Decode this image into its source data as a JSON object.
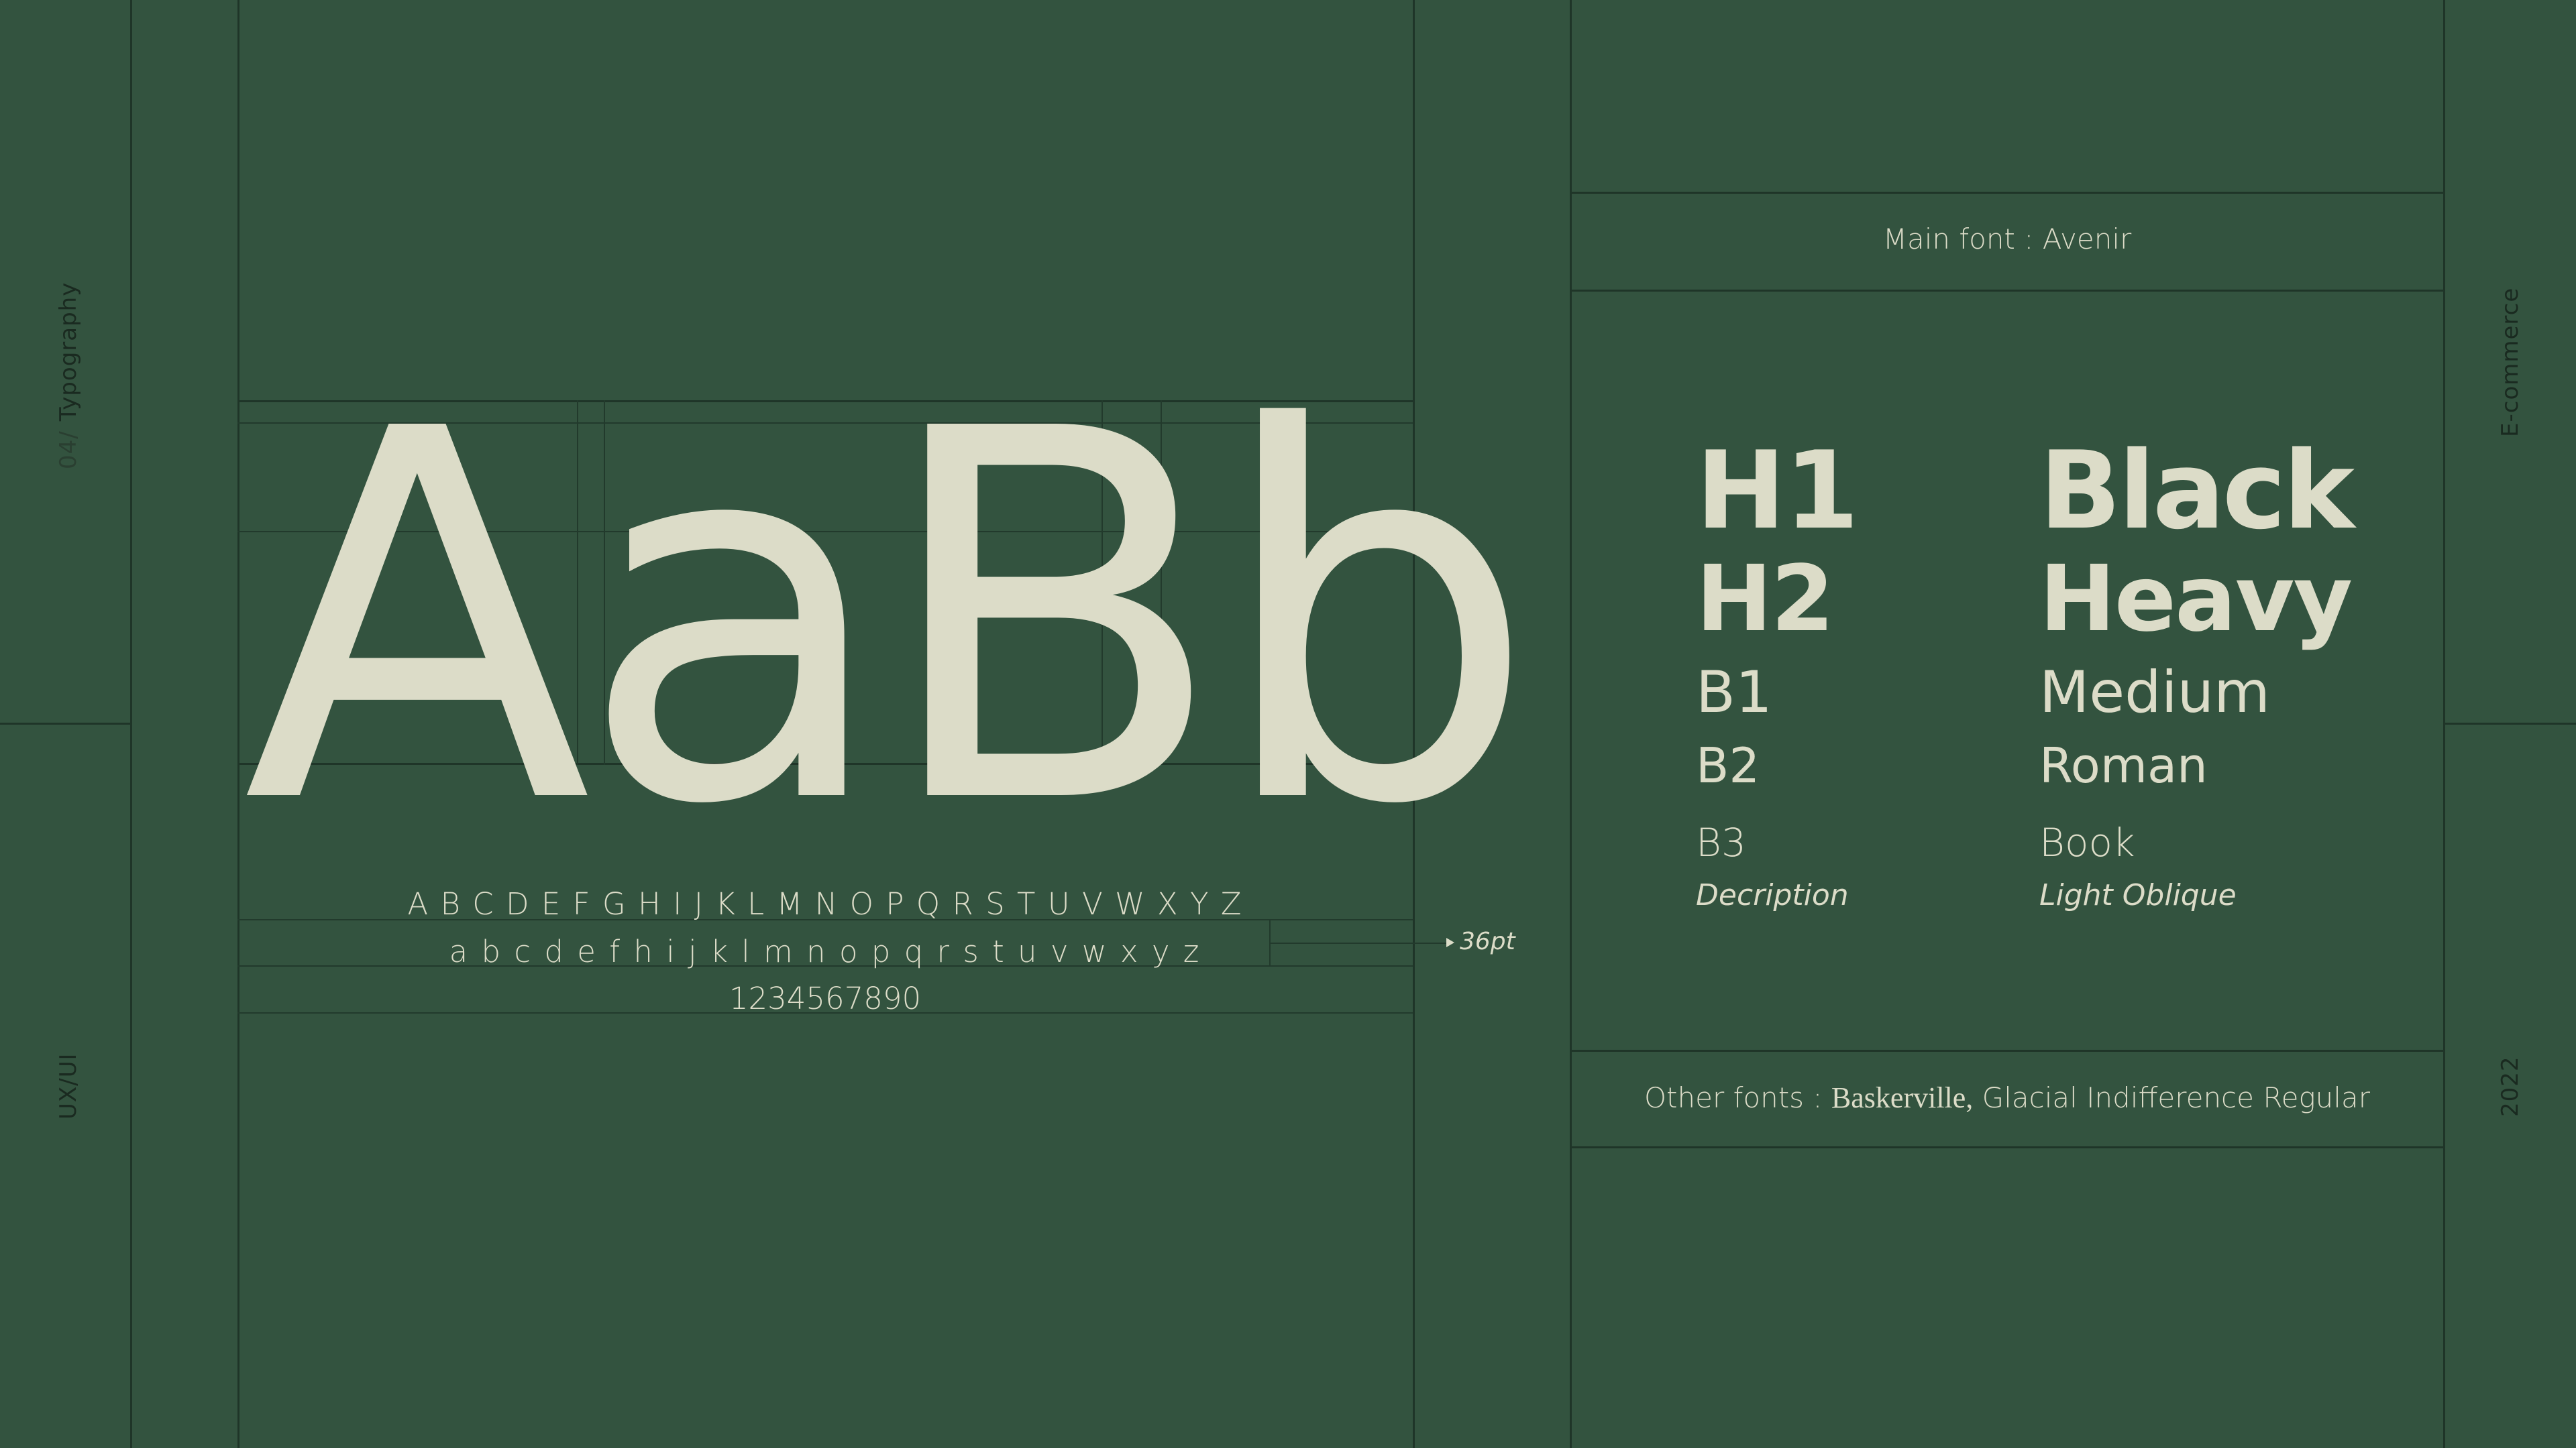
{
  "side": {
    "left_top_number": "04/",
    "left_top_label": "Typography",
    "left_bottom_label": "UX/UI",
    "right_top_label": "E-commerce",
    "right_bottom_label": "2022"
  },
  "specimen": {
    "glyphs": "AaBb",
    "uppercase": "A B C D E F G H I J K L M N O  P Q R S T U V W X Y Z",
    "lowercase": "a b c d e f  h i j k l m n o p q r s t u v w x y z",
    "numbers": "1234567890",
    "size_note": "36pt"
  },
  "fonts": {
    "main_label": "Main font : Avenir",
    "other_label": "Other fonts :",
    "other_serif": "Baskerville,",
    "other_sans": "Glacial Indifference Regular"
  },
  "styles": [
    {
      "name": "H1",
      "weight": "Black"
    },
    {
      "name": "H2",
      "weight": "Heavy"
    },
    {
      "name": "B1",
      "weight": "Medium"
    },
    {
      "name": "B2",
      "weight": "Roman"
    },
    {
      "name": "B3",
      "weight": "Book"
    },
    {
      "name": "Decription",
      "weight": "Light Oblique"
    }
  ],
  "colors": {
    "background": "#33533f",
    "text": "#dcdcc8",
    "lines": "#1f3528"
  }
}
